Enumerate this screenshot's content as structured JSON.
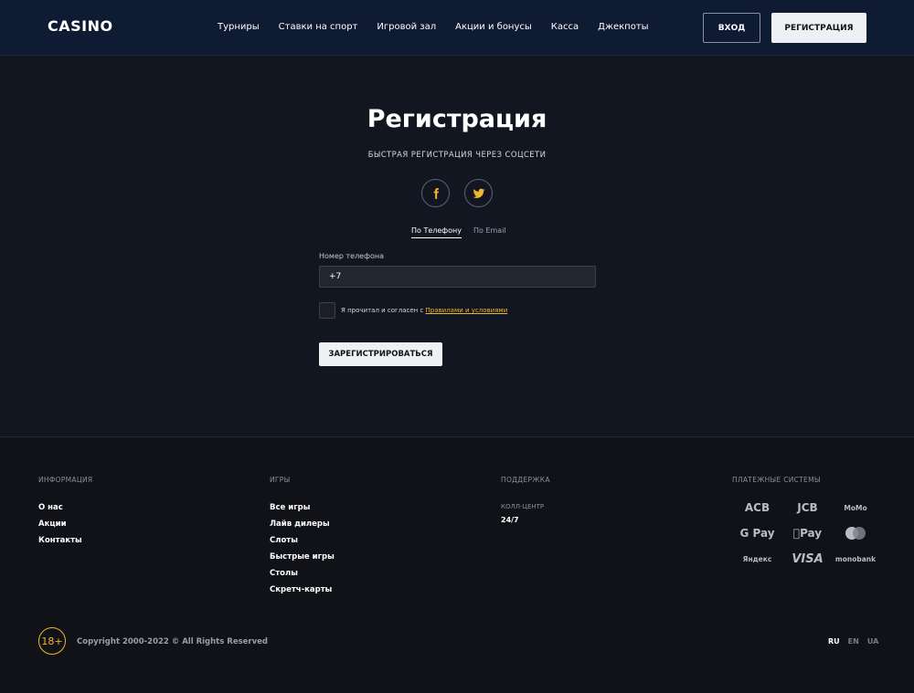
{
  "header": {
    "logo": "CASINO",
    "nav": [
      "Турниры",
      "Ставки на спорт",
      "Игровой зал",
      "Акции и бонусы",
      "Касса",
      "Джекпоты"
    ],
    "login_label": "ВХОД",
    "register_label": "РЕГИСТРАЦИЯ"
  },
  "form": {
    "title": "Регистрация",
    "subtitle": "БЫСТРАЯ РЕГИСТРАЦИЯ ЧЕРЕЗ СОЦСЕТИ",
    "tabs": [
      "По Телефону",
      "По Email"
    ],
    "phone_label": "Номер телефона",
    "phone_value": "+7",
    "agree_text": "Я прочитал и согласен с ",
    "agree_link": "Правилами и условиями",
    "submit_label": "ЗАРЕГИСТРИРОВАТЬСЯ",
    "icons": [
      "facebook-icon",
      "twitter-icon"
    ]
  },
  "footer": {
    "info": {
      "heading": "ИНФОРМАЦИЯ",
      "links": [
        "О нас",
        "Акции",
        "Контакты"
      ]
    },
    "games": {
      "heading": "ИГРЫ",
      "links": [
        "Все игры",
        "Лайв дилеры",
        "Слоты",
        "Быстрые игры",
        "Столы",
        "Скретч-карты"
      ]
    },
    "support": {
      "heading": "ПОДДЕРЖКА",
      "sub": "КОЛЛ-ЦЕНТР",
      "value": "24/7"
    },
    "payments": {
      "heading": "ПЛАТЕЖНЫЕ СИСТЕМЫ",
      "items": [
        "ACB",
        "JCB",
        "MoMo",
        "G Pay",
        "Pay",
        "mastercard",
        "Яндекс",
        "VISA",
        "monobank"
      ]
    },
    "age": "18+",
    "copyright": "Copyright 2000-2022 © All Rights Reserved",
    "langs": [
      "RU",
      "EN",
      "UA"
    ]
  },
  "colors": {
    "accent": "#f0b62c",
    "header_bg": "#0f1a33",
    "page_bg": "#121621"
  }
}
